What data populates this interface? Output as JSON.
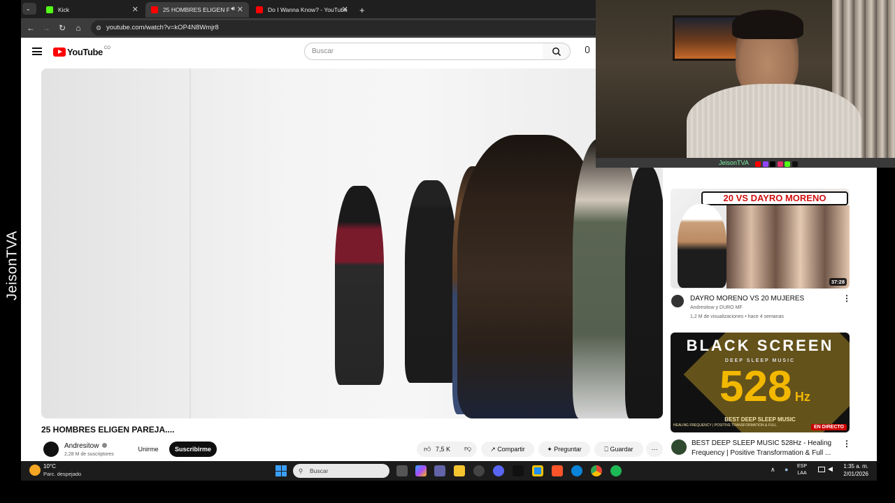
{
  "overlay": {
    "stream_label": "JeisonTVA"
  },
  "tabs": [
    {
      "label": "Kick",
      "favicon_color": "#53fc18"
    },
    {
      "label": "25 HOMBRES ELIGEN PARE...",
      "favicon_color": "#ff0000",
      "active": true
    },
    {
      "label": "Do I Wanna Know? - YouTube",
      "favicon_color": "#ff0000"
    }
  ],
  "new_tab_symbol": "+",
  "address": {
    "url": "youtube.com/watch?v=kOP4N8Wmjr8"
  },
  "youtube": {
    "logo_text": "YouTube",
    "country_code": "CO",
    "search_placeholder": "Buscar"
  },
  "video": {
    "title": "25 HOMBRES ELIGEN PAREJA....",
    "channel": "Andresitow",
    "subscribers": "2,28 M de suscriptores",
    "join_label": "Unirme",
    "subscribe_label": "Suscribirme",
    "likes": "7,5 K",
    "share_label": "Compartir",
    "ask_label": "Preguntar",
    "save_label": "Guardar"
  },
  "sidebar": [
    {
      "thumb_text": "20 VS DAYRO MORENO",
      "duration": "37:28",
      "title": "DAYRO MORENO VS 20 MUJERES",
      "channel_line": "Andresitow y DURO MF",
      "meta": "1,2 M de visualizaciones • hace 4 semanas"
    },
    {
      "thumb_heading": "BLACK SCREEN",
      "thumb_sub": "DEEP SLEEP MUSIC",
      "thumb_number": "528",
      "thumb_unit": "Hz",
      "thumb_caption": "BEST DEEP SLEEP MUSIC",
      "thumb_caption2": "HEALING FREQUENCY | POSITIVE TRANSFORMATION & FULL",
      "live_badge": "EN DIRECTO",
      "title_line1": "BEST DEEP SLEEP MUSIC 528Hz - Healing",
      "title_line2": "Frequency | Positive Transformation & Full ..."
    }
  ],
  "webcam_bar": {
    "name": "JeisonTVA"
  },
  "taskbar": {
    "weather_temp": "10°C",
    "weather_desc": "Parc. despejado",
    "search_placeholder": "Buscar",
    "lang_line1": "ESP",
    "lang_line2": "LAA",
    "time": "1:35 a. m.",
    "date": "2/01/2026"
  }
}
